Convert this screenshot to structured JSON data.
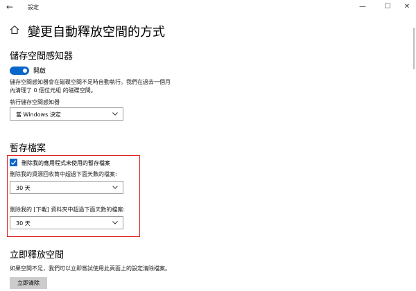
{
  "window": {
    "title": "設定",
    "min_symbol": "—",
    "max_symbol": "☐",
    "close_symbol": "✕",
    "back_symbol": "←"
  },
  "page": {
    "title": "變更自動釋放空間的方式"
  },
  "storage_sense": {
    "heading": "儲存空間感知器",
    "toggle_state": "on",
    "toggle_label": "開啟",
    "description_line1": "儲存空間感知器會在磁碟空間不足時自動執行。我們在過去一個月",
    "description_line2": "內清理了 0 個位元組 的磁碟空間。",
    "run_label": "執行儲存空間感知器",
    "run_value": "當 Windows 決定"
  },
  "temp_files": {
    "heading": "暫存檔案",
    "delete_temp_checked": true,
    "delete_temp_label": "刪除我的應用程式未使用的暫存檔案",
    "recycle_label": "刪除我的資源回收筒中超過下面天數的檔案:",
    "recycle_value": "30 天",
    "downloads_label": "刪除我的 [下載] 資料夾中超過下面天數的檔案:",
    "downloads_value": "30 天"
  },
  "free_now": {
    "heading": "立即釋放空間",
    "description": "如果空間不足，我們可以立即嘗試使用此頁面上的設定清除檔案。",
    "button_label": "立即清除"
  },
  "colors": {
    "accent": "#0a66c9",
    "highlight_border": "#e02020"
  }
}
